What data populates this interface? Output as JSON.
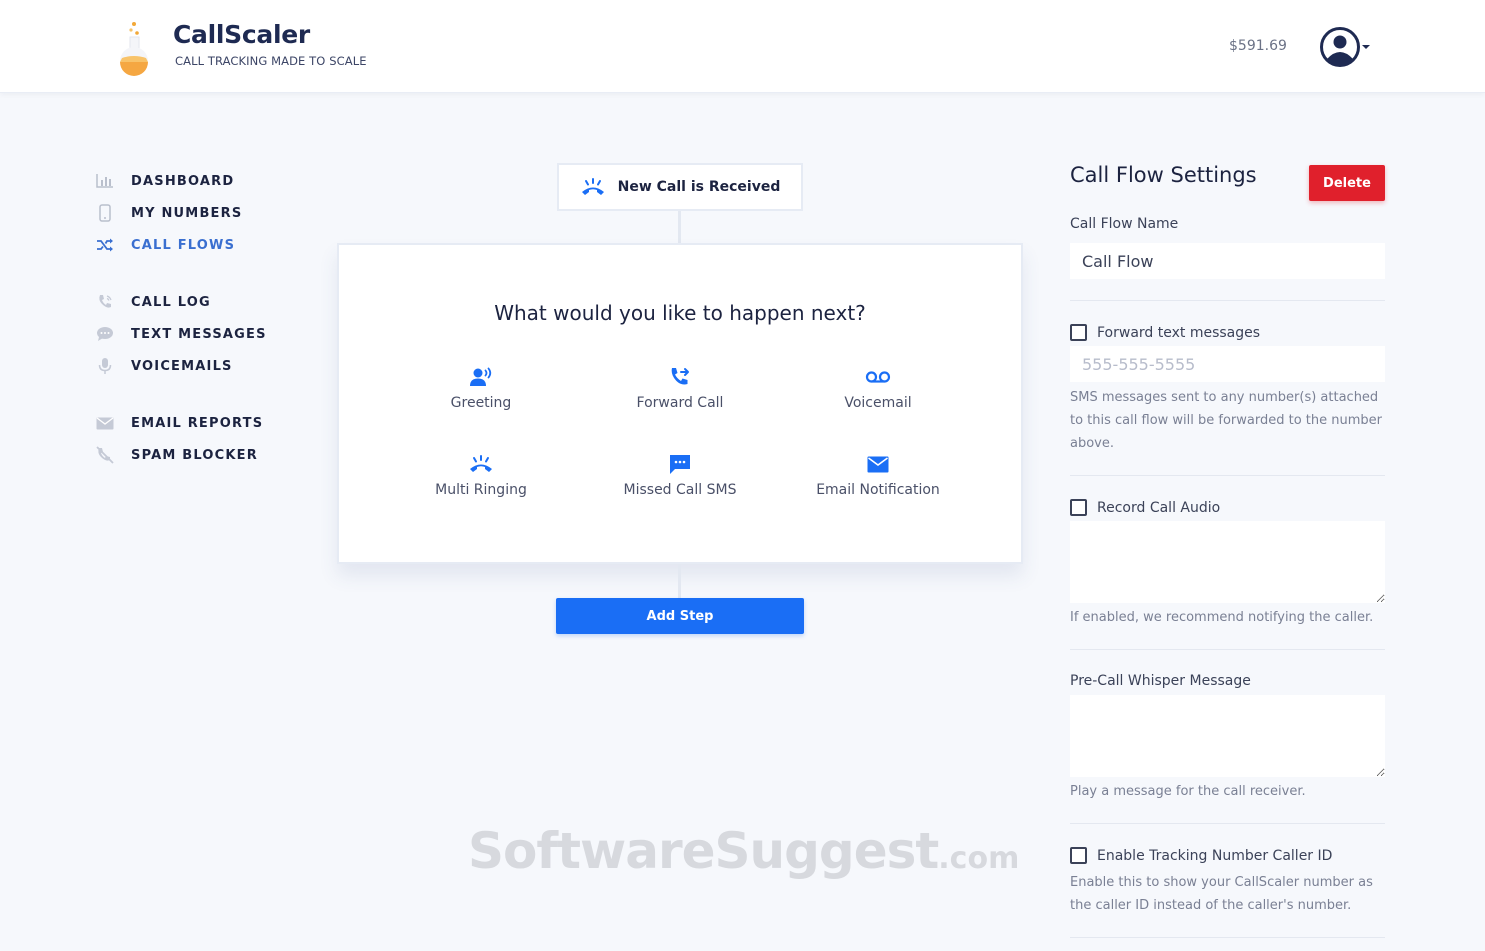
{
  "brand": {
    "name": "CallScaler",
    "tagline": "CALL TRACKING MADE TO SCALE"
  },
  "header": {
    "balance": "$591.69"
  },
  "sidebar": {
    "items": [
      {
        "label": "DASHBOARD",
        "icon": "bar-chart-icon"
      },
      {
        "label": "MY NUMBERS",
        "icon": "phone-device-icon"
      },
      {
        "label": "CALL FLOWS",
        "icon": "shuffle-icon",
        "active": true
      },
      {
        "label": "CALL LOG",
        "icon": "phone-call-icon"
      },
      {
        "label": "TEXT MESSAGES",
        "icon": "chat-bubble-icon"
      },
      {
        "label": "VOICEMAILS",
        "icon": "microphone-icon"
      },
      {
        "label": "EMAIL REPORTS",
        "icon": "envelope-icon"
      },
      {
        "label": "SPAM BLOCKER",
        "icon": "phone-blocked-icon"
      }
    ]
  },
  "flow": {
    "trigger_label": "New Call is Received",
    "question": "What would you like to happen next?",
    "options": [
      {
        "label": "Greeting",
        "icon": "speaking-person-icon"
      },
      {
        "label": "Forward Call",
        "icon": "phone-forward-icon"
      },
      {
        "label": "Voicemail",
        "icon": "voicemail-icon"
      },
      {
        "label": "Multi Ringing",
        "icon": "ringing-phone-icon"
      },
      {
        "label": "Missed Call SMS",
        "icon": "sms-bubble-icon"
      },
      {
        "label": "Email Notification",
        "icon": "envelope-icon"
      }
    ],
    "add_step_label": "Add Step"
  },
  "watermark": {
    "main": "SoftwareSuggest",
    "suffix": ".com"
  },
  "settings": {
    "title": "Call Flow Settings",
    "delete_label": "Delete",
    "call_flow_name_label": "Call Flow Name",
    "call_flow_name_value": "Call Flow",
    "forward_text_label": "Forward text messages",
    "forward_text_checked": false,
    "forward_text_placeholder": "555-555-5555",
    "forward_text_help": "SMS messages sent to any number(s) attached to this call flow will be forwarded to the number above.",
    "record_audio_label": "Record Call Audio",
    "record_audio_checked": false,
    "record_audio_help": "If enabled, we recommend notifying the caller.",
    "whisper_label": "Pre-Call Whisper Message",
    "whisper_help": "Play a message for the call receiver.",
    "tracking_caller_id_label": "Enable Tracking Number Caller ID",
    "tracking_caller_id_checked": false,
    "tracking_caller_id_help": "Enable this to show your CallScaler number as the caller ID instead of the caller's number."
  },
  "colors": {
    "primary": "#1a6ef5",
    "danger": "#e0202c",
    "active_nav": "#3a6fd0",
    "text_dark": "#1c2340",
    "background": "#f6f8fc"
  }
}
